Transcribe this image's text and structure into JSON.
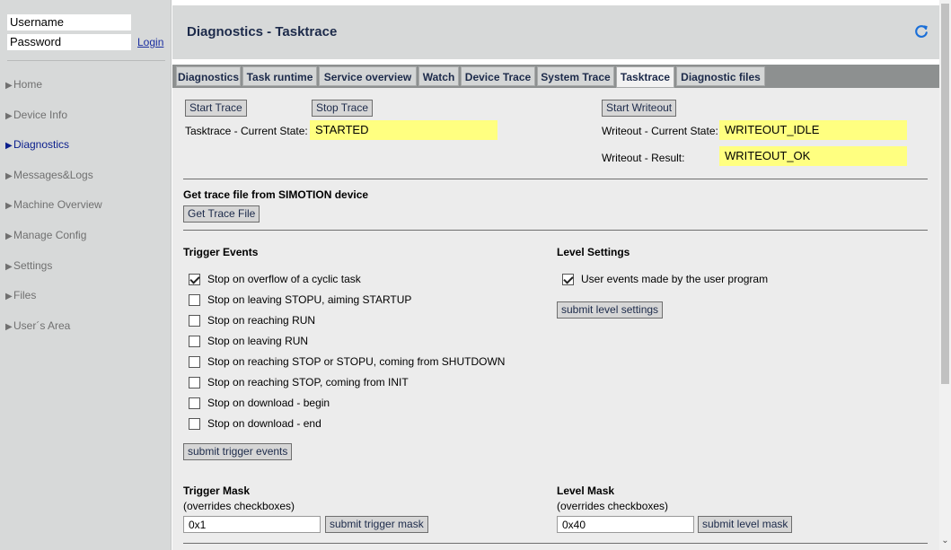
{
  "login": {
    "username_value": "Username",
    "password_value": "Password",
    "login_link": "Login"
  },
  "sidebar": {
    "items": [
      {
        "label": "Home",
        "active": false
      },
      {
        "label": "Device Info",
        "active": false
      },
      {
        "label": "Diagnostics",
        "active": true
      },
      {
        "label": "Messages&Logs",
        "active": false
      },
      {
        "label": "Machine Overview",
        "active": false
      },
      {
        "label": "Manage Config",
        "active": false
      },
      {
        "label": "Settings",
        "active": false
      },
      {
        "label": "Files",
        "active": false
      },
      {
        "label": "User´s Area",
        "active": false
      }
    ]
  },
  "header": {
    "title": "Diagnostics - Tasktrace",
    "refresh_icon": "refresh-icon",
    "accent_color": "#1a6fd8"
  },
  "tabs": [
    {
      "label": "Diagnostics",
      "active": false
    },
    {
      "label": "Task runtime",
      "active": false
    },
    {
      "label": "Service overview",
      "active": false
    },
    {
      "label": "Watch",
      "active": false
    },
    {
      "label": "Device Trace",
      "active": false
    },
    {
      "label": "System Trace",
      "active": false
    },
    {
      "label": "Tasktrace",
      "active": true
    },
    {
      "label": "Diagnostic files",
      "active": false
    }
  ],
  "trace": {
    "start_label": "Start Trace",
    "stop_label": "Stop Trace",
    "writeout_label": "Start Writeout",
    "current_state_label": "Tasktrace - Current State:",
    "current_state_value": "STARTED",
    "writeout_state_label": "Writeout - Current State:",
    "writeout_state_value": "WRITEOUT_IDLE",
    "writeout_result_label": "Writeout - Result:",
    "writeout_result_value": "WRITEOUT_OK",
    "highlight_color": "#ffff80"
  },
  "get_file": {
    "heading": "Get trace file from SIMOTION device",
    "button_label": "Get Trace File"
  },
  "trigger_events": {
    "heading": "Trigger Events",
    "items": [
      {
        "label": "Stop on overflow of a cyclic task",
        "checked": true
      },
      {
        "label": "Stop on leaving STOPU, aiming STARTUP",
        "checked": false
      },
      {
        "label": "Stop on reaching RUN",
        "checked": false
      },
      {
        "label": "Stop on leaving RUN",
        "checked": false
      },
      {
        "label": "Stop on reaching STOP or STOPU, coming from SHUTDOWN",
        "checked": false
      },
      {
        "label": "Stop on reaching STOP, coming from INIT",
        "checked": false
      },
      {
        "label": "Stop on download - begin",
        "checked": false
      },
      {
        "label": "Stop on download - end",
        "checked": false
      }
    ],
    "submit_label": "submit trigger events"
  },
  "level_settings": {
    "heading": "Level Settings",
    "items": [
      {
        "label": "User events made by the user program",
        "checked": true
      }
    ],
    "submit_label": "submit level settings"
  },
  "trigger_mask": {
    "heading": "Trigger Mask",
    "note": "(overrides checkboxes)",
    "value": "0x1",
    "submit_label": "submit trigger mask"
  },
  "level_mask": {
    "heading": "Level Mask",
    "note": "(overrides checkboxes)",
    "value": "0x40",
    "submit_label": "submit level mask"
  }
}
